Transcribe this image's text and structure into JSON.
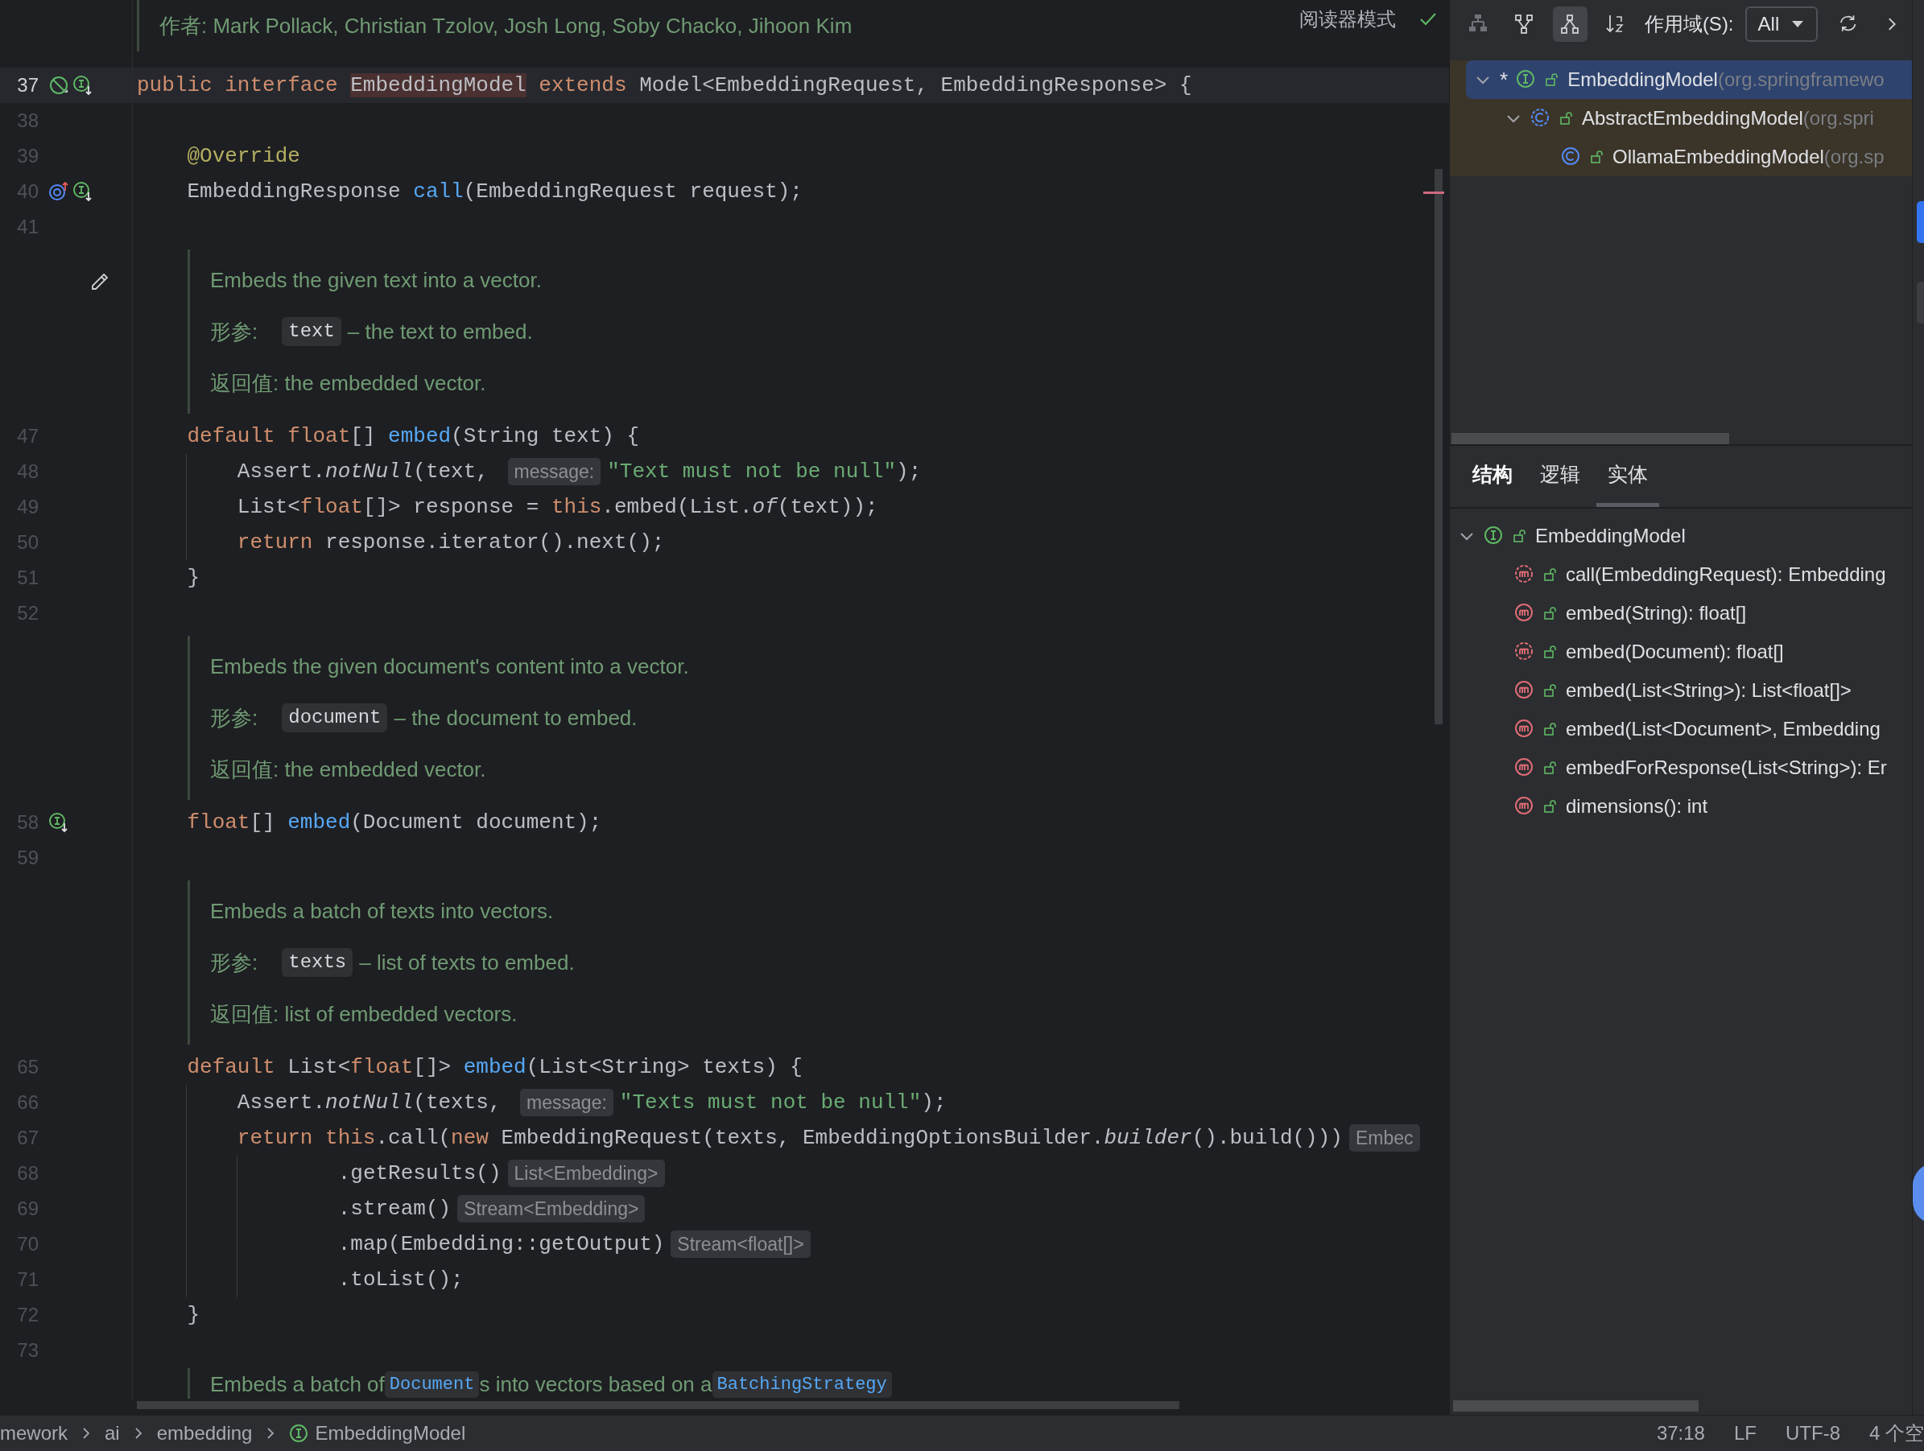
{
  "editor": {
    "reader_mode": "阅读器模式",
    "rows": [
      {
        "kind": "doc",
        "paragraphs": [
          [
            {
              "kind": "text",
              "text": "作者: Mark Pollack, Christian Tzolov, Josh Long, Soby Chacko, Jihoon Kim"
            }
          ]
        ]
      },
      {
        "kind": "code",
        "number": "37",
        "current": true,
        "markers": [
          {
            "kind": "no-implementations"
          },
          {
            "kind": "implemented"
          }
        ],
        "tokens": [
          {
            "kind": "kw",
            "text": "public interface "
          },
          {
            "kind": "hl",
            "text": "EmbeddingModel"
          },
          {
            "kind": "kw",
            "text": " extends "
          },
          {
            "kind": "plain",
            "text": "Model<EmbeddingRequest, EmbeddingResponse> {"
          }
        ]
      },
      {
        "kind": "code",
        "number": "38",
        "current": false,
        "markers": [],
        "tokens": []
      },
      {
        "kind": "code",
        "number": "39",
        "current": false,
        "markers": [],
        "tokens": [
          {
            "kind": "ann",
            "text": "    @Override"
          }
        ]
      },
      {
        "kind": "code",
        "number": "40",
        "current": false,
        "markers": [
          {
            "kind": "overrides"
          },
          {
            "kind": "implemented"
          }
        ],
        "tokens": [
          {
            "kind": "plain",
            "text": "    EmbeddingResponse "
          },
          {
            "kind": "fn",
            "text": "call"
          },
          {
            "kind": "plain",
            "text": "(EmbeddingRequest request);"
          }
        ]
      },
      {
        "kind": "code",
        "number": "41",
        "current": false,
        "markers": [],
        "tokens": []
      },
      {
        "kind": "doc",
        "markers": [
          {
            "kind": "edit"
          }
        ],
        "paragraphs": [
          [
            {
              "kind": "text",
              "text": "Embeds the given text into a vector."
            }
          ],
          [
            {
              "kind": "label",
              "text": "形参:"
            },
            {
              "kind": "code",
              "text": "text"
            },
            {
              "kind": "text",
              "text": "– the text to embed."
            }
          ],
          [
            {
              "kind": "text",
              "text": "返回值: the embedded vector."
            }
          ]
        ]
      },
      {
        "kind": "code",
        "number": "47",
        "current": false,
        "markers": [],
        "tokens": [
          {
            "kind": "kw",
            "text": "    default float"
          },
          {
            "kind": "plain",
            "text": "[] "
          },
          {
            "kind": "fn",
            "text": "embed"
          },
          {
            "kind": "plain",
            "text": "(String text) {"
          }
        ]
      },
      {
        "kind": "code",
        "number": "48",
        "current": false,
        "markers": [],
        "tokens": [
          {
            "kind": "plain",
            "text": "        Assert."
          },
          {
            "kind": "ital",
            "text": "notNull"
          },
          {
            "kind": "plain",
            "text": "(text, "
          },
          {
            "kind": "hint",
            "text": "message:"
          },
          {
            "kind": "str",
            "text": "\"Text must not be null\""
          },
          {
            "kind": "plain",
            "text": ");"
          }
        ]
      },
      {
        "kind": "code",
        "number": "49",
        "current": false,
        "markers": [],
        "tokens": [
          {
            "kind": "plain",
            "text": "        List<"
          },
          {
            "kind": "kw",
            "text": "float"
          },
          {
            "kind": "plain",
            "text": "[]> response = "
          },
          {
            "kind": "kw",
            "text": "this"
          },
          {
            "kind": "plain",
            "text": ".embed(List."
          },
          {
            "kind": "ital",
            "text": "of"
          },
          {
            "kind": "plain",
            "text": "(text));"
          }
        ]
      },
      {
        "kind": "code",
        "number": "50",
        "current": false,
        "markers": [],
        "tokens": [
          {
            "kind": "kw",
            "text": "        return "
          },
          {
            "kind": "plain",
            "text": "response.iterator().next();"
          }
        ]
      },
      {
        "kind": "code",
        "number": "51",
        "current": false,
        "markers": [],
        "tokens": [
          {
            "kind": "plain",
            "text": "    }"
          }
        ]
      },
      {
        "kind": "code",
        "number": "52",
        "current": false,
        "markers": [],
        "tokens": []
      },
      {
        "kind": "doc",
        "paragraphs": [
          [
            {
              "kind": "text",
              "text": "Embeds the given document's content into a vector."
            }
          ],
          [
            {
              "kind": "label",
              "text": "形参:"
            },
            {
              "kind": "code",
              "text": "document"
            },
            {
              "kind": "text",
              "text": "– the document to embed."
            }
          ],
          [
            {
              "kind": "text",
              "text": "返回值: the embedded vector."
            }
          ]
        ]
      },
      {
        "kind": "code",
        "number": "58",
        "current": false,
        "markers": [
          {
            "kind": "implemented"
          }
        ],
        "tokens": [
          {
            "kind": "kw",
            "text": "    float"
          },
          {
            "kind": "plain",
            "text": "[] "
          },
          {
            "kind": "fn",
            "text": "embed"
          },
          {
            "kind": "plain",
            "text": "(Document document);"
          }
        ]
      },
      {
        "kind": "code",
        "number": "59",
        "current": false,
        "markers": [],
        "tokens": []
      },
      {
        "kind": "doc",
        "paragraphs": [
          [
            {
              "kind": "text",
              "text": "Embeds a batch of texts into vectors."
            }
          ],
          [
            {
              "kind": "label",
              "text": "形参:"
            },
            {
              "kind": "code",
              "text": "texts"
            },
            {
              "kind": "text",
              "text": "– list of texts to embed."
            }
          ],
          [
            {
              "kind": "text",
              "text": "返回值: list of embedded vectors."
            }
          ]
        ]
      },
      {
        "kind": "code",
        "number": "65",
        "current": false,
        "markers": [],
        "tokens": [
          {
            "kind": "kw",
            "text": "    default "
          },
          {
            "kind": "plain",
            "text": "List<"
          },
          {
            "kind": "kw",
            "text": "float"
          },
          {
            "kind": "plain",
            "text": "[]> "
          },
          {
            "kind": "fn",
            "text": "embed"
          },
          {
            "kind": "plain",
            "text": "(List<String> texts) {"
          }
        ]
      },
      {
        "kind": "code",
        "number": "66",
        "current": false,
        "markers": [],
        "tokens": [
          {
            "kind": "plain",
            "text": "        Assert."
          },
          {
            "kind": "ital",
            "text": "notNull"
          },
          {
            "kind": "plain",
            "text": "(texts, "
          },
          {
            "kind": "hint",
            "text": "message:"
          },
          {
            "kind": "str",
            "text": "\"Texts must not be null\""
          },
          {
            "kind": "plain",
            "text": ");"
          }
        ]
      },
      {
        "kind": "code",
        "number": "67",
        "current": false,
        "markers": [],
        "tokens": [
          {
            "kind": "kw",
            "text": "        return this"
          },
          {
            "kind": "plain",
            "text": ".call("
          },
          {
            "kind": "kw",
            "text": "new "
          },
          {
            "kind": "plain",
            "text": "EmbeddingRequest(texts, EmbeddingOptionsBuilder."
          },
          {
            "kind": "ital",
            "text": "builder"
          },
          {
            "kind": "plain",
            "text": "().build()))"
          },
          {
            "kind": "hint",
            "text": "Embec"
          }
        ]
      },
      {
        "kind": "code",
        "number": "68",
        "current": false,
        "markers": [],
        "tokens": [
          {
            "kind": "plain",
            "text": "                .getResults()"
          },
          {
            "kind": "hint",
            "text": "List<Embedding>"
          }
        ]
      },
      {
        "kind": "code",
        "number": "69",
        "current": false,
        "markers": [],
        "tokens": [
          {
            "kind": "plain",
            "text": "                .stream()"
          },
          {
            "kind": "hint",
            "text": "Stream<Embedding>"
          }
        ]
      },
      {
        "kind": "code",
        "number": "70",
        "current": false,
        "markers": [],
        "tokens": [
          {
            "kind": "plain",
            "text": "                .map(Embedding::getOutput)"
          },
          {
            "kind": "hint",
            "text": "Stream<float[]>"
          }
        ]
      },
      {
        "kind": "code",
        "number": "71",
        "current": false,
        "markers": [],
        "tokens": [
          {
            "kind": "plain",
            "text": "                .toList();"
          }
        ]
      },
      {
        "kind": "code",
        "number": "72",
        "current": false,
        "markers": [],
        "tokens": [
          {
            "kind": "plain",
            "text": "    }"
          }
        ]
      },
      {
        "kind": "code",
        "number": "73",
        "current": false,
        "markers": [],
        "tokens": []
      },
      {
        "kind": "doc",
        "paragraphs": [
          [
            {
              "kind": "text",
              "text": "Embeds a batch of "
            },
            {
              "kind": "link",
              "text": "Document"
            },
            {
              "kind": "text",
              "text": "s into vectors based on a "
            },
            {
              "kind": "link",
              "text": "BatchingStrategy"
            }
          ]
        ]
      }
    ],
    "breadcrumbs": [
      {
        "kind": "package",
        "text": "mework"
      },
      {
        "kind": "package",
        "text": "ai"
      },
      {
        "kind": "package",
        "text": "embedding"
      },
      {
        "kind": "interface",
        "text": "EmbeddingModel"
      }
    ]
  },
  "hierarchy": {
    "buttons": [
      {
        "kind": "supertypes",
        "selected": false
      },
      {
        "kind": "subtypes",
        "selected": false
      },
      {
        "kind": "type-hierarchy",
        "selected": true
      },
      {
        "kind": "sort",
        "selected": false
      }
    ],
    "scope_label": "作用域(S):",
    "scope_value": "All",
    "actions": [
      {
        "kind": "refresh"
      },
      {
        "kind": "next"
      }
    ],
    "tree": [
      {
        "marker": "*",
        "kind": "interface",
        "text": "EmbeddingModel",
        "detail": "(org.springframewo",
        "selected": true,
        "expanded": true,
        "children": [
          {
            "kind": "abstract-class",
            "text": "AbstractEmbeddingModel",
            "detail": "(org.spri",
            "selected": false,
            "expanded": true,
            "children": [
              {
                "kind": "class",
                "text": "OllamaEmbeddingModel",
                "detail": "(org.sp",
                "selected": false
              }
            ]
          }
        ]
      }
    ]
  },
  "structure": {
    "tabs": [
      {
        "label": "结构",
        "bold": true,
        "selected": false
      },
      {
        "label": "逻辑",
        "bold": false,
        "selected": false
      },
      {
        "label": "实体",
        "bold": false,
        "selected": true
      }
    ],
    "tree": [
      {
        "kind": "interface",
        "text": "EmbeddingModel",
        "expanded": true,
        "children": [
          {
            "kind": "abstract-method",
            "text": "call(EmbeddingRequest): Embedding"
          },
          {
            "kind": "method",
            "text": "embed(String): float[]"
          },
          {
            "kind": "abstract-method",
            "text": "embed(Document): float[]"
          },
          {
            "kind": "method",
            "text": "embed(List<String>): List<float[]>"
          },
          {
            "kind": "method",
            "text": "embed(List<Document>, Embedding"
          },
          {
            "kind": "method",
            "text": "embedForResponse(List<String>): Er"
          },
          {
            "kind": "method",
            "text": "dimensions(): int"
          }
        ]
      }
    ]
  },
  "status_bar": [
    "37:18",
    "LF",
    "UTF-8",
    "4 个空"
  ]
}
